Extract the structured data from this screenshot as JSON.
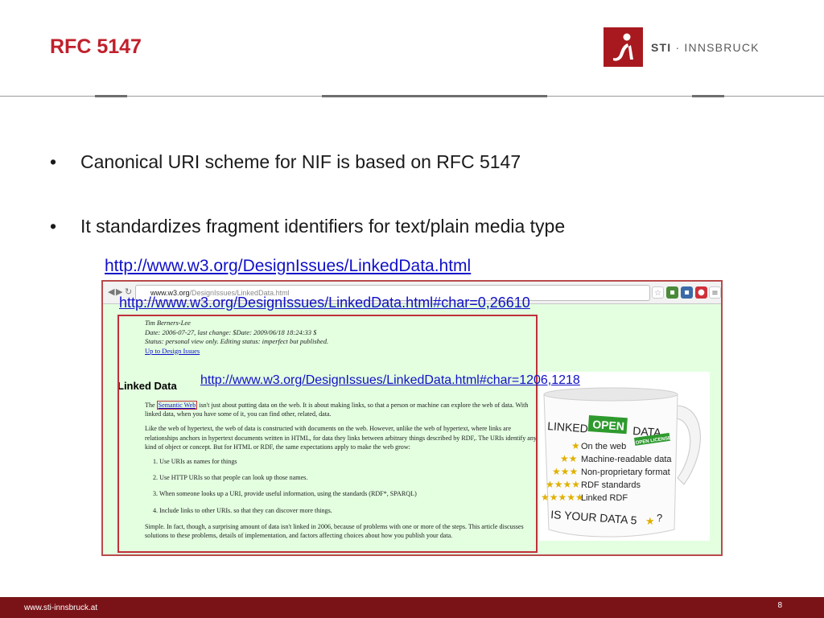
{
  "slide": {
    "title": "RFC 5147",
    "bullets": [
      "Canonical URI scheme for NIF is based on RFC 5147",
      "It standardizes fragment identifiers for text/plain media type"
    ],
    "bullet_glyph": "•",
    "links": {
      "main": "http://www.w3.org/DesignIssues/LinkedData.html",
      "char_range_1": "http://www.w3.org/DesignIssues/LinkedData.html#char=0,26610",
      "char_range_2": "http://www.w3.org/DesignIssues/LinkedData.html#char=1206,1218"
    }
  },
  "logo": {
    "name_bold": "STI",
    "name_rest": " · INNSBRUCK",
    "icon": "sti-logo-icon",
    "color": "#a8181f"
  },
  "screenshot": {
    "url_host": "www.w3.org",
    "url_path": "/DesignIssues/LinkedData.html",
    "nav_back": "◀",
    "nav_forward": "▶",
    "nav_reload": "↻",
    "meta": {
      "author": "Tim Berners-Lee",
      "date": "Date: 2006-07-27, last change: $Date: 2009/06/18 18:24:33 $",
      "status": "Status: personal view only. Editing status: imperfect but published.",
      "up_link": "Up to Design Issues"
    },
    "heading": "Linked Data",
    "intro_pre": "The ",
    "intro_term": "Semantic Web",
    "intro_post": " isn't just about putting data on the web. It is about making links, so that a person or machine can explore the web of data.  With linked data, when you have some of it, you can find other, related, data.",
    "para2": "Like the web of hypertext, the web of data is constructed with documents on the web. However,  unlike the web of hypertext, where links are relationships anchors in hypertext documents written in HTML, for data they links  between arbitrary things described by RDF,.  The URIs identify any kind of object or  concept.   But for HTML or RDF, the same expectations apply to make the web grow:",
    "rules": [
      "1.  Use URIs as names for things",
      "2.  Use HTTP URIs so that people can look up those names.",
      "3.  When someone looks up a URI, provide useful information, using the standards (RDF*, SPARQL)",
      "4.  Include links to other URIs. so that they can discover more things."
    ],
    "closing": "Simple.  In fact, though, a surprising amount of data isn't linked in 2006, because of problems with one or more of the steps.  This article discusses solutions to these problems, details of implementation, and factors affecting choices about how you publish your data.",
    "mug": {
      "line1_a": "LINKED",
      "line1_b": "OPEN",
      "line1_c": "DATA",
      "items": [
        "On the web",
        "Machine-readable data",
        "Non-proprietary format",
        "RDF standards",
        "Linked RDF"
      ],
      "badge": "OPEN LICENSE",
      "tagline": "IS YOUR DATA 5",
      "tagline_end": "?",
      "star_color": "#e0b000",
      "green": "#2e9a2e"
    }
  },
  "footer": {
    "url": "www.sti-innsbruck.at",
    "page": "8",
    "color": "#7a1317"
  }
}
